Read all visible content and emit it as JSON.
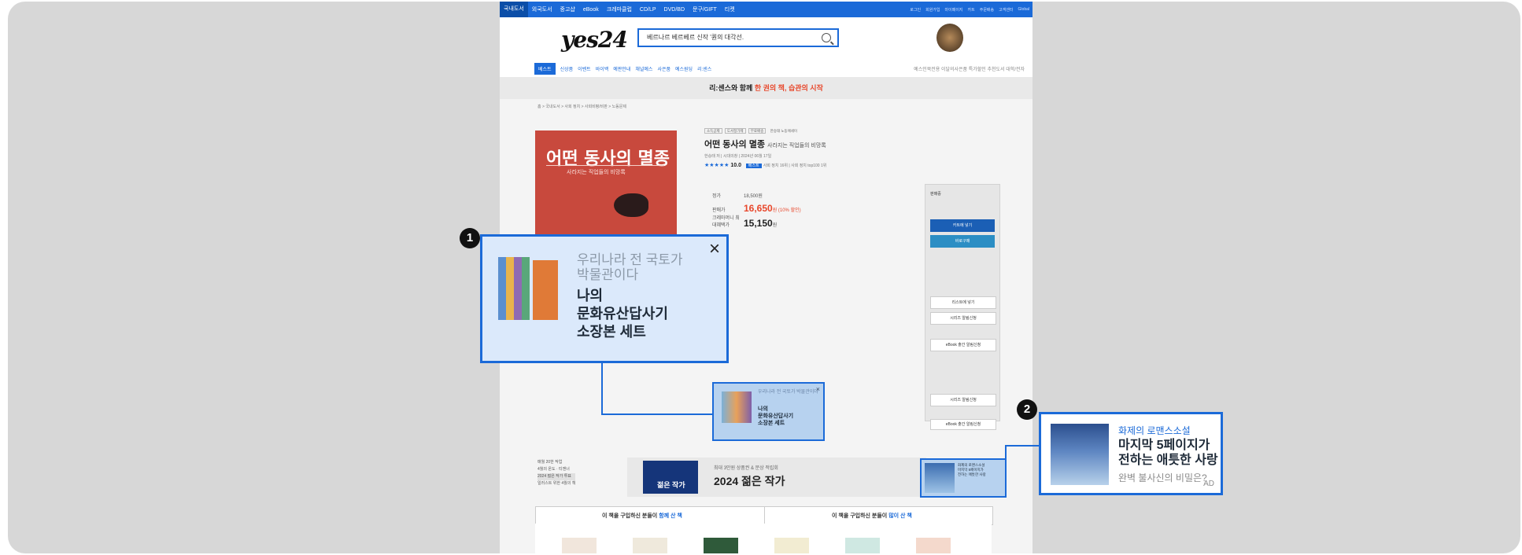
{
  "colors": {
    "accent": "#1b6ad8",
    "frame": "#d7d7d7",
    "sale_red": "#e8472b",
    "marker": "#111111"
  },
  "topnav": {
    "items": [
      "국내도서",
      "외국도서",
      "중고샵",
      "eBook",
      "크레마클럽",
      "CD/LP",
      "DVD/BD",
      "문구/GIFT",
      "티켓"
    ],
    "right": [
      "로그인",
      "회원가입",
      "마이페이지",
      "카트",
      "주문배송",
      "고객센터",
      "Global"
    ]
  },
  "header": {
    "logo": "yes24",
    "search_value": "베르나르 베르베르 신작 '퀀의 대각선.",
    "search_icon": "search-icon"
  },
  "catnav": {
    "button": "베스트",
    "items": [
      "베스트",
      "신상품",
      "이벤트",
      "바이백",
      "예판안내",
      "채널예스",
      "사은품",
      "예스원딩",
      "리:센스"
    ],
    "right": "예스인북전용   이달의사은품   특가할인   추천도서   대학/전자"
  },
  "banner": {
    "text_plain": "리:센스와 함께",
    "text_highlight": "한 권의 책, 습관의 시작"
  },
  "breadcrumb": "홈 > 국내도서 > 사회 정치 > 사회비평/비판 > 노동문제",
  "book": {
    "cover_title": "어떤 동사의 멸종",
    "cover_subtitle": "사라지는 직업들의 비망록",
    "tags": [
      "소득공제",
      "도서정가제",
      "무료배송",
      "한승태 노동에세이"
    ],
    "title": "어떤 동사의 멸종",
    "subtitle": "사라지는 직업들의 비망록",
    "meta": "한승태 저 | 시대의창 | 2024년 06월 17일",
    "rating": "10.0",
    "rating_stars": "★★★★★",
    "best_badge": "베스트",
    "best_text": "사회 정치 16위 | 사회 정치 top100 1위",
    "list_price_label": "정가",
    "list_price": "18,500원",
    "sale_label": "판매가",
    "sale_price": "16,650",
    "sale_unit": "원 (10% 할인)",
    "crema_label": "크레마머니 최대혜택가",
    "crema_price": "15,150",
    "crema_unit": "원"
  },
  "order": {
    "caption": "판매중",
    "cart": "카트에 넣기",
    "buy": "바로구매",
    "list_add": "리스트에 넣기",
    "series_alert": "시리즈 알림신청",
    "ebook_alert": "eBook 출간 알림신청"
  },
  "small_popup": {
    "subtitle": "우리나라 전 국토가 박물관이다",
    "title_lines": [
      "나의",
      "문화유산답사기",
      "소장본 세트"
    ],
    "close": "×"
  },
  "popup": {
    "subtitle_lines": [
      "우리나라 전 국토가",
      "박물관이다"
    ],
    "title_lines": [
      "나의",
      "문화유산답사기",
      "소장본 세트"
    ],
    "close": "×"
  },
  "markers": [
    "1",
    "2"
  ],
  "row2": {
    "list": [
      "매월 20한 작업",
      "4월의 온도 · 티젠너",
      "2024 젊은 작가 투표",
      "일러스트 위한 4월의 책"
    ],
    "promo_badge": "젊은 작가",
    "promo_line1": "최대 3만원 상품권 & 문상 적립회",
    "promo_line2": "2024 젊은 작가"
  },
  "ad2": {
    "category": "화제의 로맨스소설",
    "title_lines": [
      "마지막 5페이지가",
      "전하는 애틋한 사랑"
    ],
    "footer": "완벽 불사신의 비밀은?",
    "tag": "AD"
  },
  "tabs": {
    "left_plain": "이 책을 구입하신 분들이",
    "left_hl": "함께 산 책",
    "right_plain": "이 책을 구입하신 분들이",
    "right_hl": "많이 산 책"
  }
}
